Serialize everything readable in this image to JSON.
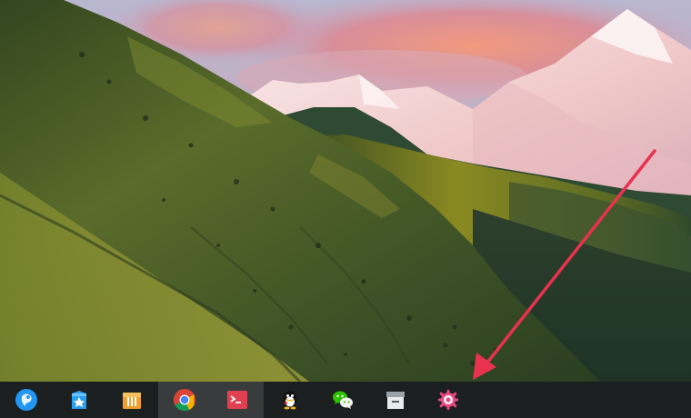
{
  "taskbar": {
    "items": [
      {
        "icon": "launcher-icon",
        "active": false
      },
      {
        "icon": "app-store-icon",
        "active": false
      },
      {
        "icon": "file-manager-icon",
        "active": false
      },
      {
        "icon": "chrome-icon",
        "active": true
      },
      {
        "icon": "terminal-icon",
        "active": true
      },
      {
        "icon": "qq-icon",
        "active": false
      },
      {
        "icon": "wechat-icon",
        "active": false
      },
      {
        "icon": "archive-manager-icon",
        "active": false
      },
      {
        "icon": "settings-icon",
        "active": false
      }
    ]
  },
  "colors": {
    "taskbar_bg": "#1c1e20",
    "arrow": "#e8324f",
    "launcher": "#2196f3",
    "app_store": "#2b9ef0",
    "file_manager": "#f0a030",
    "terminal": "#e04050",
    "settings": "#e84a80"
  }
}
